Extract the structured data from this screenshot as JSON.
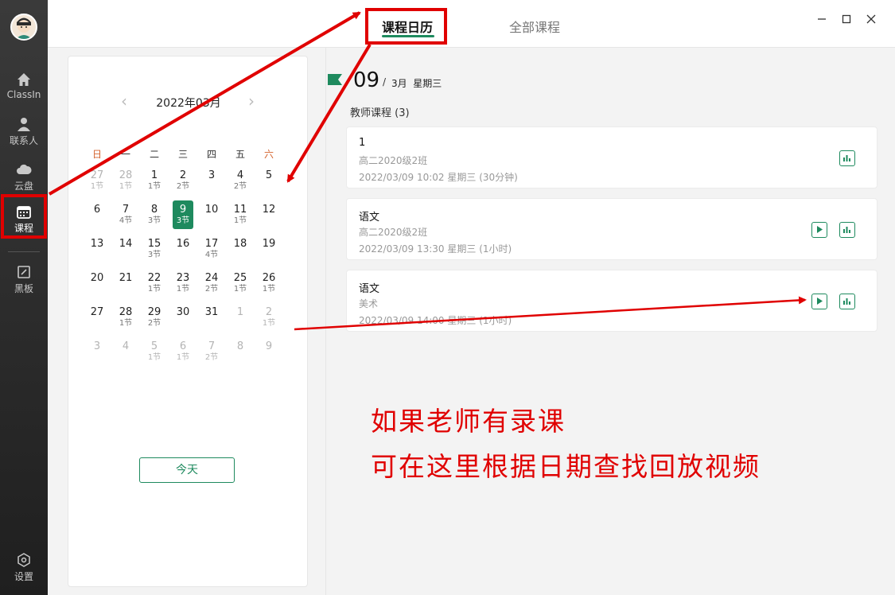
{
  "sidebar": {
    "items": [
      {
        "label": "ClassIn",
        "icon": "home-icon"
      },
      {
        "label": "联系人",
        "icon": "person-icon"
      },
      {
        "label": "云盘",
        "icon": "cloud-icon"
      },
      {
        "label": "课程",
        "icon": "calendar-icon"
      },
      {
        "label": "黑板",
        "icon": "blackboard-icon"
      },
      {
        "label": "设置",
        "icon": "settings-icon"
      }
    ]
  },
  "tabs": {
    "calendar": "课程日历",
    "all": "全部课程"
  },
  "calendar": {
    "month_label": "2022年03月",
    "weekdays": [
      "日",
      "一",
      "二",
      "三",
      "四",
      "五",
      "六"
    ],
    "weeks": [
      [
        {
          "n": "27",
          "s": "1节",
          "o": true
        },
        {
          "n": "28",
          "s": "1节",
          "o": true
        },
        {
          "n": "1",
          "s": "1节"
        },
        {
          "n": "2",
          "s": "2节"
        },
        {
          "n": "3",
          "s": ""
        },
        {
          "n": "4",
          "s": "2节"
        },
        {
          "n": "5",
          "s": ""
        }
      ],
      [
        {
          "n": "6",
          "s": ""
        },
        {
          "n": "7",
          "s": "4节"
        },
        {
          "n": "8",
          "s": "3节"
        },
        {
          "n": "9",
          "s": "3节",
          "sel": true
        },
        {
          "n": "10",
          "s": ""
        },
        {
          "n": "11",
          "s": "1节"
        },
        {
          "n": "12",
          "s": ""
        }
      ],
      [
        {
          "n": "13",
          "s": ""
        },
        {
          "n": "14",
          "s": ""
        },
        {
          "n": "15",
          "s": "3节"
        },
        {
          "n": "16",
          "s": ""
        },
        {
          "n": "17",
          "s": "4节"
        },
        {
          "n": "18",
          "s": ""
        },
        {
          "n": "19",
          "s": ""
        }
      ],
      [
        {
          "n": "20",
          "s": ""
        },
        {
          "n": "21",
          "s": ""
        },
        {
          "n": "22",
          "s": "1节"
        },
        {
          "n": "23",
          "s": "1节"
        },
        {
          "n": "24",
          "s": "2节"
        },
        {
          "n": "25",
          "s": "1节"
        },
        {
          "n": "26",
          "s": "1节"
        }
      ],
      [
        {
          "n": "27",
          "s": ""
        },
        {
          "n": "28",
          "s": "1节"
        },
        {
          "n": "29",
          "s": "2节"
        },
        {
          "n": "30",
          "s": ""
        },
        {
          "n": "31",
          "s": ""
        },
        {
          "n": "1",
          "s": "",
          "o": true
        },
        {
          "n": "2",
          "s": "1节",
          "o": true
        }
      ],
      [
        {
          "n": "3",
          "s": "",
          "o": true
        },
        {
          "n": "4",
          "s": "",
          "o": true
        },
        {
          "n": "5",
          "s": "1节",
          "o": true
        },
        {
          "n": "6",
          "s": "1节",
          "o": true
        },
        {
          "n": "7",
          "s": "2节",
          "o": true
        },
        {
          "n": "8",
          "s": "",
          "o": true
        },
        {
          "n": "9",
          "s": "",
          "o": true
        }
      ]
    ],
    "today_label": "今天"
  },
  "date_header": {
    "day": "09",
    "sep": "/",
    "rest": "3月  星期三"
  },
  "section_title": "教师课程 (3)",
  "courses": [
    {
      "title": "1",
      "class": "高二2020级2班",
      "time": "2022/03/09 10:02 星期三 (30分钟)",
      "play": false
    },
    {
      "title": "语文",
      "class": "高二2020级2班",
      "time": "2022/03/09 13:30 星期三 (1小时)",
      "play": true
    },
    {
      "title": "语文",
      "class": "美术",
      "time": "2022/03/09 14:00 星期三 (1小时)",
      "play": true
    }
  ],
  "annotation": {
    "line1": "如果老师有录课",
    "line2": "可在这里根据日期查找回放视频",
    "color": "#e00000"
  },
  "colors": {
    "accent": "#1e8a5e",
    "sidebar": "#2b2b2b",
    "weekend": "#d4622c"
  }
}
